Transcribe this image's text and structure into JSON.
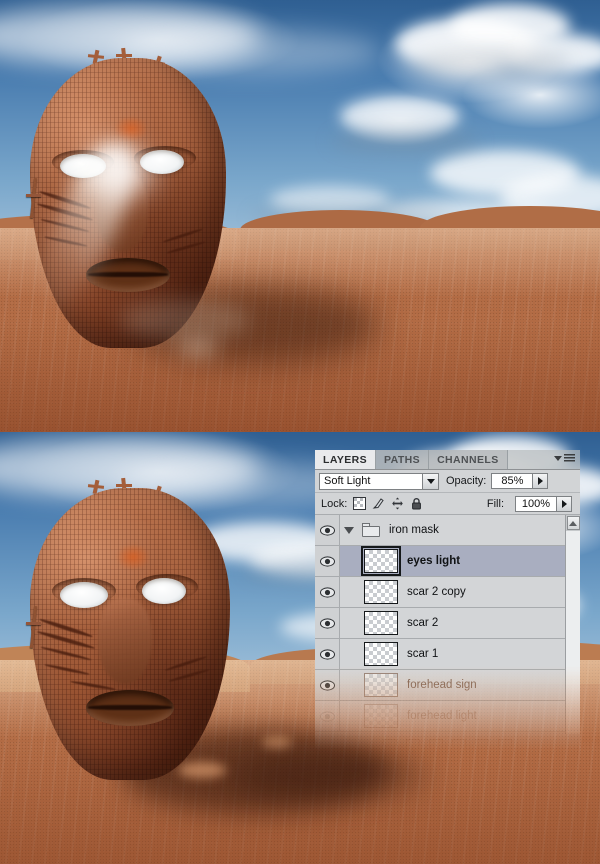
{
  "scene": {
    "top_image": {
      "alt": "desert mask composite without shadow refinement"
    },
    "bottom_image": {
      "alt": "desert mask composite final with eyes light"
    },
    "colors": {
      "sky_top": "#2f5f92",
      "sky_low": "#cfd9dc",
      "sand": "#b26b44",
      "mask_skin": "#9c5634"
    }
  },
  "panel": {
    "tabs": [
      {
        "label": "LAYERS",
        "active": true
      },
      {
        "label": "PATHS",
        "active": false
      },
      {
        "label": "CHANNELS",
        "active": false
      }
    ],
    "menu_icon": "panel-menu-icon",
    "blend_mode": {
      "value": "Soft Light",
      "arrow": "chevron-down-icon"
    },
    "opacity": {
      "label": "Opacity:",
      "value": "85%",
      "stepper": "chevron-right-icon"
    },
    "fill": {
      "label": "Fill:",
      "value": "100%",
      "stepper": "chevron-right-icon"
    },
    "lock": {
      "label": "Lock:",
      "items": [
        {
          "name": "lock-transparent-pixels-icon"
        },
        {
          "name": "lock-image-pixels-icon"
        },
        {
          "name": "lock-position-icon"
        },
        {
          "name": "lock-all-icon"
        }
      ]
    },
    "layers": [
      {
        "name": "iron mask",
        "type": "group",
        "visible": true,
        "selected": false,
        "expanded": true,
        "faded": false,
        "bold": false
      },
      {
        "name": "eyes light",
        "type": "layer",
        "visible": true,
        "selected": true,
        "expanded": false,
        "faded": false,
        "bold": true
      },
      {
        "name": "scar 2 copy",
        "type": "layer",
        "visible": true,
        "selected": false,
        "expanded": false,
        "faded": false,
        "bold": false
      },
      {
        "name": "scar 2",
        "type": "layer",
        "visible": true,
        "selected": false,
        "expanded": false,
        "faded": false,
        "bold": false
      },
      {
        "name": "scar 1",
        "type": "layer",
        "visible": true,
        "selected": false,
        "expanded": false,
        "faded": false,
        "bold": false
      },
      {
        "name": "forehead sign",
        "type": "layer",
        "visible": true,
        "selected": false,
        "expanded": false,
        "faded": true,
        "bold": false
      },
      {
        "name": "forehead light",
        "type": "layer",
        "visible": false,
        "selected": false,
        "expanded": false,
        "faded": true,
        "bold": false
      }
    ],
    "scrollbar": {
      "up_arrow": "scroll-up-icon"
    }
  }
}
